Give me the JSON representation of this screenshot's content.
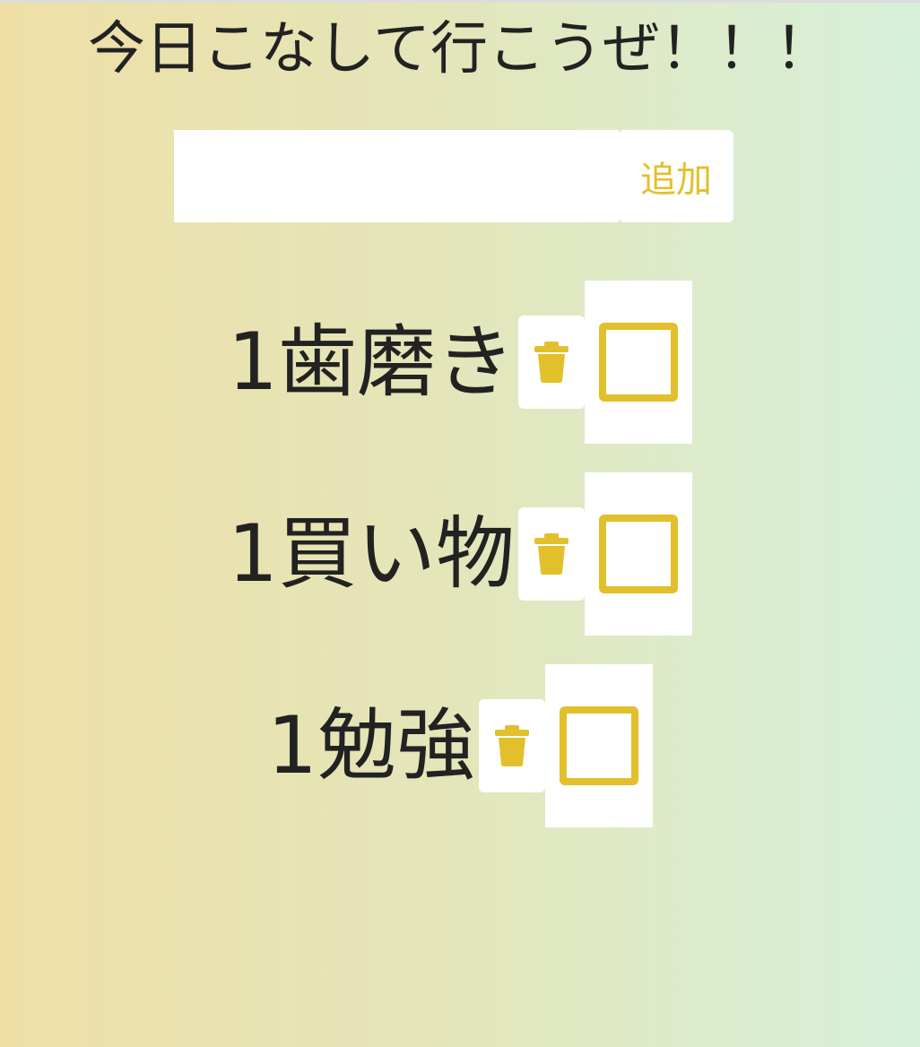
{
  "header": {
    "title": "今日こなして行こうぜ！！！"
  },
  "form": {
    "input_value": "",
    "input_placeholder": "",
    "add_label": "追加"
  },
  "todos": [
    {
      "label": "1歯磨き",
      "checked": false
    },
    {
      "label": "1買い物",
      "checked": false
    },
    {
      "label": "1勉強",
      "checked": false
    }
  ],
  "icons": {
    "delete": "trash-icon",
    "check": "checkbox-icon"
  },
  "colors": {
    "accent": "#e2c02c",
    "text": "#222222",
    "gradient_left": "#efdfa6",
    "gradient_right": "#d6f0da"
  }
}
